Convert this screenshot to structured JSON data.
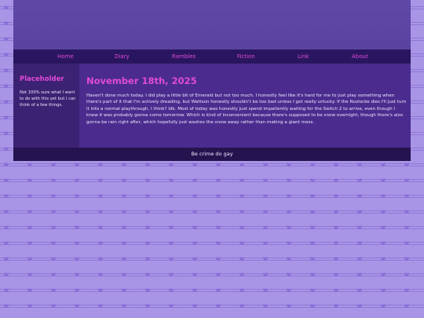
{
  "nav": {
    "items": [
      "Home",
      "Diary",
      "Rambles",
      "Fiction",
      "Link",
      "About"
    ]
  },
  "sidebar": {
    "title": "Placeholder",
    "text": "Not 100% sure what I want to do with this yet but I can think of a few things."
  },
  "post": {
    "date": "November 18th, 2025",
    "body": "Haven't done much today. I did play a little bit of Emerald but not too much. I honestly feel like it's hard for me to just play something when there's part of it that I'm actively dreading, but Wattson honestly shouldn't be too bad unless I get really unlucky. If the Nuzlocke dies I'll just turn it into a normal playthrough, I think? Idk. Most of today was honestly just spend impatiently waiting for the Switch 2 to arrive, even though I knew it was probably gonna come tomorrow. Which is kind of inconvenient because there's supposed to be snow overnight, though there's also gonna be rain right after, which hopefully just washes the snow away rather than making a giant mess."
  },
  "footer": {
    "text": "Be crime do gay"
  },
  "colors": {
    "accent": "#e04ad8",
    "background": "#a995e6",
    "banner": "#5a43a0",
    "nav": "#2a1660",
    "content": "#4b2c8e",
    "footer": "#25134f"
  },
  "icons": {
    "background_pattern": "heart-icon"
  }
}
